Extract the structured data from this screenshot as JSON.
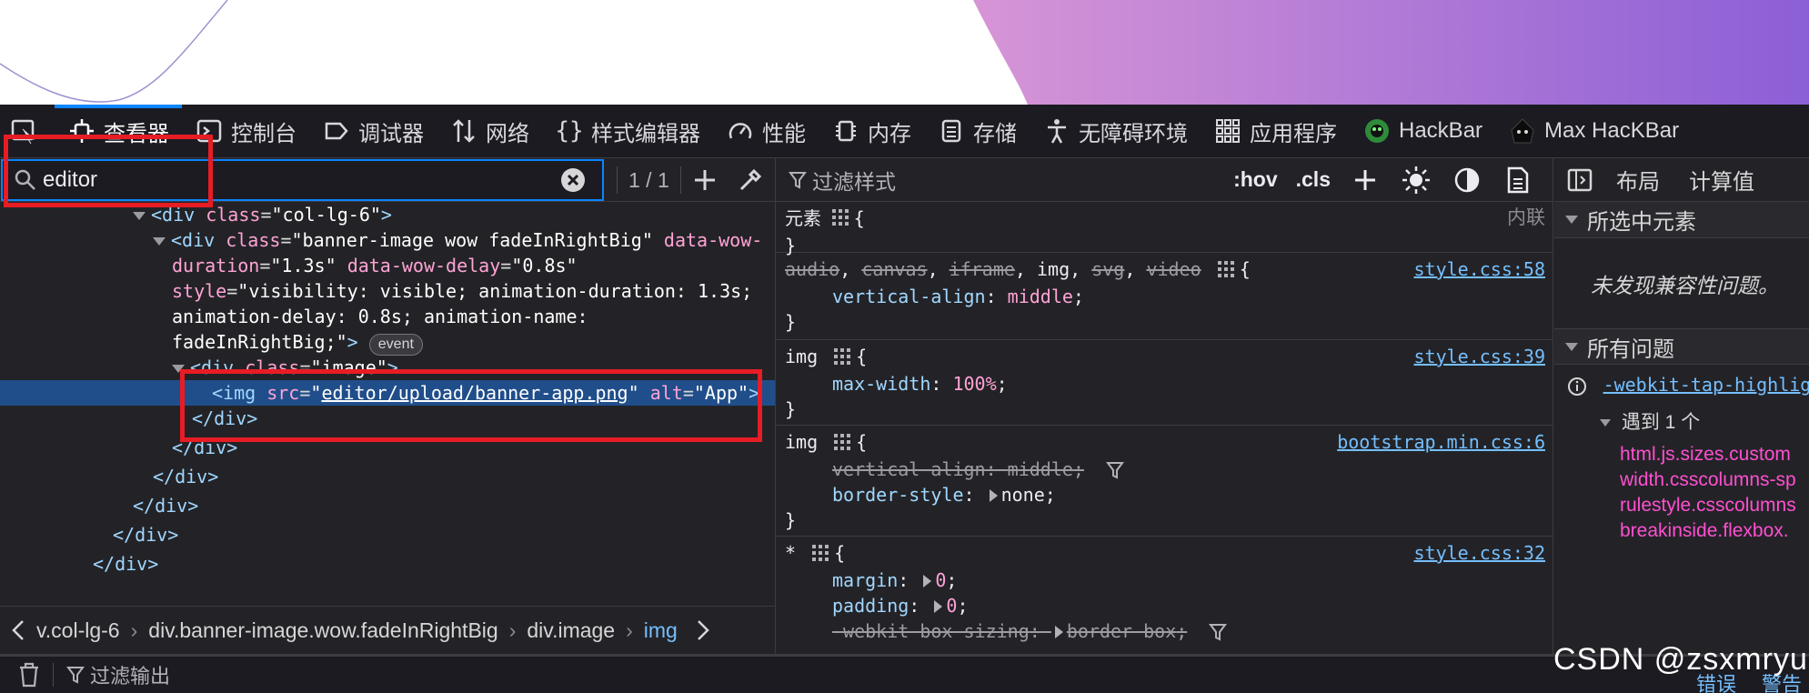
{
  "toolbar": {
    "items": [
      {
        "label": "查看器",
        "icon": "inspector-icon"
      },
      {
        "label": "控制台",
        "icon": "console-icon"
      },
      {
        "label": "调试器",
        "icon": "debugger-icon"
      },
      {
        "label": "网络",
        "icon": "network-icon"
      },
      {
        "label": "样式编辑器",
        "icon": "style-editor-icon"
      },
      {
        "label": "性能",
        "icon": "performance-icon"
      },
      {
        "label": "内存",
        "icon": "memory-icon"
      },
      {
        "label": "存储",
        "icon": "storage-icon"
      },
      {
        "label": "无障碍环境",
        "icon": "accessibility-icon"
      },
      {
        "label": "应用程序",
        "icon": "application-icon"
      },
      {
        "label": "HackBar",
        "icon": "hackbar-icon"
      },
      {
        "label": "Max HacKBar",
        "icon": "max-hackbar-icon"
      }
    ]
  },
  "search": {
    "value": "editor",
    "match_count": "1 / 1"
  },
  "tree": {
    "l1_tag": "div",
    "l1_attr": "class",
    "l1_val": "col-lg-6",
    "l2_tag": "div",
    "l2_attr1": "class",
    "l2_val1": "banner-image wow fadeInRightBig",
    "l2_attr2": "data-wow-",
    "l3_attr2b": "duration",
    "l3_val2": "1.3s",
    "l3_attr3": "data-wow-delay",
    "l3_val3": "0.8s",
    "l4_attr4": "style",
    "l4_val4a": "visibility: visible; animation-duration: 1.3s;",
    "l5_val4b": "animation-delay: 0.8s; animation-name:",
    "l6_val4c": "fadeInRightBig;",
    "event_label": "event",
    "l7_tag": "div",
    "l7_attr": "class",
    "l7_val": "image",
    "l8_tag": "img",
    "l8_attr1": "src",
    "l8_val1": "editor/upload/banner-app.png",
    "l8_attr2": "alt",
    "l8_val2": "App",
    "close_div": "div"
  },
  "breadcrumbs": [
    {
      "label": "v.col-lg-6"
    },
    {
      "label": "div.banner-image.wow.fadeInRightBig"
    },
    {
      "label": "div.image"
    },
    {
      "label": "img"
    }
  ],
  "rules_toolbar": {
    "filter_placeholder": "过滤样式",
    "hov": ":hov",
    "cls": ".cls"
  },
  "rules": {
    "element_label": "元素",
    "inline_label": "内联",
    "r1_selectors": [
      "audio",
      "canvas",
      "iframe",
      "img",
      "svg",
      "video"
    ],
    "r1_src": "style.css:58",
    "r1_prop": "vertical-align",
    "r1_val": "middle",
    "r2_sel": "img",
    "r2_src": "style.css:39",
    "r2_prop": "max-width",
    "r2_val": "100%",
    "r3_sel": "img",
    "r3_src": "bootstrap.min.css:6",
    "r3_prop1": "vertical-align",
    "r3_val1": "middle",
    "r3_prop2": "border-style",
    "r3_val2": "none",
    "r4_sel": "*",
    "r4_src": "style.css:32",
    "r4_prop1": "margin",
    "r4_val1": "0",
    "r4_prop2": "padding",
    "r4_val2": "0",
    "r4_prop3": "-webkit-box-sizing",
    "r4_val3": "border-box"
  },
  "right_panel": {
    "tabs": [
      "布局",
      "计算值"
    ],
    "selected_section": "所选中元素",
    "no_issues": "未发现兼容性问题。",
    "all_issues": "所有问题",
    "issue_link": "-webkit-tap-highlig",
    "encountered": "遇到 1 个",
    "features": [
      "html.js.sizes.custom",
      "width.csscolumns-sp",
      "rulestyle.csscolumns",
      "breakinside.flexbox."
    ]
  },
  "console": {
    "filter_placeholder": "过滤输出",
    "errors_tab": "错误",
    "warnings_tab": "警告"
  },
  "watermark": "CSDN @zsxmryu",
  "colors": {
    "accent": "#0a84ff",
    "annotation_red": "#e81c24",
    "panel_bg": "#232327",
    "selected_row": "#204e8a"
  }
}
